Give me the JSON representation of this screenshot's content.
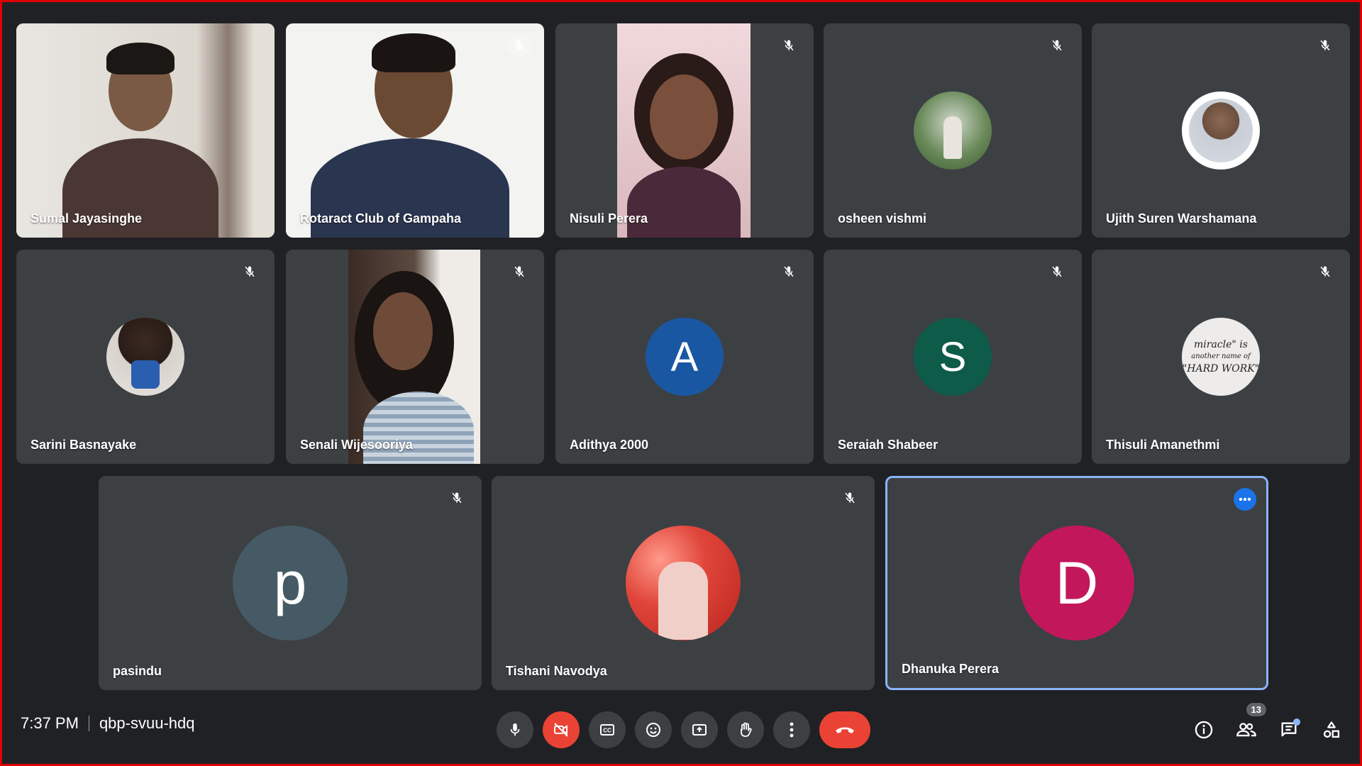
{
  "participants": [
    {
      "name": "Sumal Jayasinghe"
    },
    {
      "name": "Rotaract Club of Gampaha"
    },
    {
      "name": "Nisuli Perera"
    },
    {
      "name": "osheen vishmi"
    },
    {
      "name": "Ujith Suren Warshamana"
    },
    {
      "name": "Sarini Basnayake"
    },
    {
      "name": "Senali Wijesooriya"
    },
    {
      "name": "Adithya 2000",
      "initial": "A",
      "color": "#1a57a3"
    },
    {
      "name": "Seraiah Shabeer",
      "initial": "S",
      "color": "#0e5b4a"
    },
    {
      "name": "Thisuli Amanethmi"
    },
    {
      "name": "pasindu",
      "initial": "p",
      "color": "#455a64"
    },
    {
      "name": "Tishani Navodya"
    },
    {
      "name": "Dhanuka Perera",
      "initial": "D",
      "color": "#c2185b"
    }
  ],
  "thisuli_avatar_text": {
    "line1": "miracle\" is",
    "line2": "another name of",
    "line3": "\"HARD WORK\""
  },
  "meeting": {
    "time": "7:37 PM",
    "code": "qbp-svuu-hdq"
  },
  "people_count": "13",
  "icons": {
    "mic": "mic-icon",
    "camera_off": "camera-off-icon",
    "captions": "captions-icon",
    "emoji": "emoji-icon",
    "present": "present-screen-icon",
    "hand": "raise-hand-icon",
    "more": "more-vert-icon",
    "end_call": "end-call-icon",
    "info": "info-icon",
    "people": "people-icon",
    "chat": "chat-icon",
    "activities": "activities-icon"
  },
  "colors": {
    "end_call": "#ea4335",
    "active_border": "#8ab4f8",
    "more_btn": "#1a73e8"
  }
}
